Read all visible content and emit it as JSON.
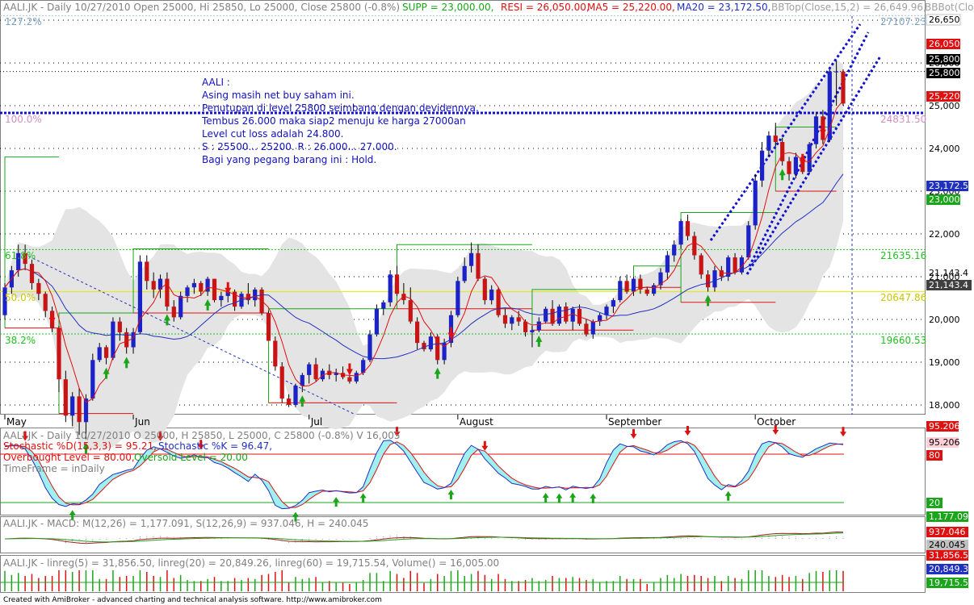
{
  "colors": {
    "up": "#1a22c8",
    "down": "#c81414",
    "ma5": "#e01010",
    "ma20": "#2030c0",
    "band": "#e6e6e6",
    "supp": "#1aa51a",
    "resi": "#e01010",
    "fib_green": "#22c022",
    "fib_yellow": "#e8e800",
    "cyan": "#80ffff"
  },
  "header": {
    "symbol_line": "AALI.JK - Daily 10/27/2010 Open 25000, Hi 25850, Lo 25000, Close 25800 (-0.8%)",
    "supp": "SUPP = 23,000.00,",
    "resi": "RESI = 26,050.00,",
    "ma5": "MA5 = 25,220.00,",
    "ma20": "MA20 = 23,172.50,",
    "bbtop": "BBTop(Close,15,2) = 26,649.96,",
    "bbbot": "BBBot(Clo"
  },
  "annotation": [
    "AALI :",
    "Asing masih net buy saham ini.",
    "Penutupan di level 25800 seimbang dengan devidennya.",
    "Tembus 26.000 maka siap2 menuju ke harga 27000an",
    "Level cut loss adalah 24.800.",
    "S : 25500... 25200. R : 26.000... 27.000.",
    "Bagi yang pegang barang ini : Hold."
  ],
  "fib_labels": {
    "f127": "127.2%",
    "f100": "100.0%",
    "f618": "61.8%",
    "f50": "50.0%",
    "f382": "38.2%",
    "v127": "27107.23",
    "v100": "24831.50",
    "v618": "21635.16",
    "v50": "20647.86",
    "v382": "19660.53"
  },
  "price_axis": {
    "ticks": [
      "27,000",
      "26,000",
      "25,000",
      "24,000",
      "23,000",
      "22,000",
      "21,000",
      "20,000",
      "19,000",
      "18,000"
    ],
    "badges": {
      "bbtop": "26,650",
      "resi": "26,050",
      "close_a": "25,800",
      "close_b": "25,800",
      "ma5": "25,220",
      "ma20": "23,172.5",
      "supp": "23,000",
      "lvl_a": "21,143.4",
      "lvl_b": "21,143.4"
    }
  },
  "months": [
    "May",
    "Jun",
    "Jul",
    "August",
    "September",
    "October"
  ],
  "stoch": {
    "title": "AALI.JK - Daily 10/27/2010 O 25000, H 25850, L 25000, C 25800 (-0.8%) V 16,005",
    "d": "Stochastic %D(15,3,3) = 95.21,",
    "k": "Stochastic %K = 96.47,",
    "ob": "Overbought Level = 80.00,",
    "os": "Oversold Level = 20.00",
    "tf": "TimeFrame = inDaily",
    "b1": "95.206",
    "b2": "95.206",
    "b3": "80",
    "b4": "20"
  },
  "macd": {
    "title": "AALI.JK - MACD: M(12,26) = 1,177.091, S(12,26,9) = 937.046, H = 240.045",
    "b1": "1,177.09",
    "b2": "937.046",
    "b3": "240.045"
  },
  "linreg": {
    "title": "AALI.JK - linreg(5) = 31,856.50, linreg(20) = 20,849.26, linreg(60) = 19,715.54, Volume() = 16,005.00",
    "b1": "31,856.5",
    "b2": "20,849.3",
    "b3": "19,715.5"
  },
  "footer": "Created with AmiBroker - advanced charting and technical analysis software. http://www.amibroker.com",
  "chart_data": {
    "type": "candlestick",
    "title": "AALI.JK - Daily 10/27/2010",
    "y_range": [
      17800,
      27000
    ],
    "ohlc": [
      [
        20100,
        20850,
        20000,
        20750
      ],
      [
        20750,
        21250,
        20600,
        21150
      ],
      [
        21150,
        21750,
        21000,
        21550
      ],
      [
        21550,
        21750,
        21150,
        21300
      ],
      [
        21300,
        21400,
        20700,
        20850
      ],
      [
        20850,
        20950,
        20450,
        20600
      ],
      [
        20600,
        20650,
        20050,
        20200
      ],
      [
        20200,
        20300,
        19700,
        19800
      ],
      [
        19800,
        19850,
        18300,
        18600
      ],
      [
        18600,
        18800,
        17600,
        17750
      ],
      [
        17750,
        18300,
        17500,
        18200
      ],
      [
        18200,
        18400,
        17300,
        17600
      ],
      [
        17600,
        18250,
        17200,
        18150
      ],
      [
        18150,
        19200,
        18100,
        19050
      ],
      [
        19050,
        19450,
        19000,
        19350
      ],
      [
        19350,
        19400,
        18950,
        19100
      ],
      [
        19100,
        20050,
        19050,
        19950
      ],
      [
        19950,
        20050,
        19500,
        19700
      ],
      [
        19700,
        19800,
        19200,
        19350
      ],
      [
        19350,
        19800,
        19200,
        19700
      ],
      [
        19700,
        21500,
        19650,
        21350
      ],
      [
        21350,
        21500,
        20700,
        20900
      ],
      [
        20900,
        21100,
        20500,
        20700
      ],
      [
        20700,
        21050,
        20500,
        20950
      ],
      [
        20950,
        21100,
        20200,
        20300
      ],
      [
        20300,
        20450,
        19950,
        20050
      ],
      [
        20050,
        20650,
        20000,
        20550
      ],
      [
        20550,
        20800,
        20400,
        20750
      ],
      [
        20750,
        20950,
        20600,
        20850
      ],
      [
        20850,
        20900,
        20550,
        20650
      ],
      [
        20650,
        21000,
        20550,
        20950
      ],
      [
        20950,
        20950,
        20400,
        20450
      ],
      [
        20450,
        20650,
        20300,
        20550
      ],
      [
        20550,
        20750,
        20400,
        20650
      ],
      [
        20650,
        20700,
        20200,
        20300
      ],
      [
        20300,
        20650,
        20250,
        20600
      ],
      [
        20600,
        20850,
        20350,
        20450
      ],
      [
        20450,
        20750,
        20300,
        20700
      ],
      [
        20700,
        20750,
        20100,
        20150
      ],
      [
        20150,
        20200,
        19500,
        19500
      ],
      [
        19500,
        19600,
        18800,
        18900
      ],
      [
        18900,
        19000,
        18050,
        18150
      ],
      [
        18150,
        18250,
        17950,
        18000
      ],
      [
        18000,
        18500,
        17950,
        18450
      ],
      [
        18450,
        18750,
        18300,
        18700
      ],
      [
        18700,
        19000,
        18500,
        18950
      ],
      [
        18950,
        19100,
        18550,
        18600
      ],
      [
        18600,
        18850,
        18550,
        18800
      ],
      [
        18800,
        18950,
        18600,
        18700
      ],
      [
        18700,
        18850,
        18550,
        18750
      ],
      [
        18750,
        18900,
        18600,
        18650
      ],
      [
        18650,
        18700,
        18500,
        18550
      ],
      [
        18550,
        18800,
        18500,
        18750
      ],
      [
        18750,
        19100,
        18700,
        19050
      ],
      [
        19050,
        19750,
        19000,
        19650
      ],
      [
        19650,
        20350,
        19600,
        20250
      ],
      [
        20250,
        20450,
        20100,
        20400
      ],
      [
        20400,
        21150,
        20300,
        21050
      ],
      [
        21050,
        21250,
        20550,
        20600
      ],
      [
        20600,
        20850,
        20350,
        20450
      ],
      [
        20450,
        20750,
        19900,
        19950
      ],
      [
        19950,
        20050,
        19300,
        19450
      ],
      [
        19450,
        19500,
        19250,
        19300
      ],
      [
        19300,
        19700,
        19250,
        19600
      ],
      [
        19600,
        19650,
        18950,
        19050
      ],
      [
        19050,
        19550,
        18950,
        19450
      ],
      [
        19450,
        20200,
        19350,
        20100
      ],
      [
        20100,
        21000,
        20050,
        20900
      ],
      [
        20900,
        21450,
        20850,
        21250
      ],
      [
        21250,
        21800,
        21100,
        21550
      ],
      [
        21550,
        21750,
        20900,
        20950
      ],
      [
        20950,
        21000,
        20350,
        20450
      ],
      [
        20450,
        20800,
        20350,
        20700
      ],
      [
        20700,
        20750,
        20050,
        20100
      ],
      [
        20100,
        20250,
        19800,
        19900
      ],
      [
        19900,
        20100,
        19750,
        20050
      ],
      [
        20050,
        20200,
        19850,
        19950
      ],
      [
        19950,
        20000,
        19600,
        19700
      ],
      [
        19700,
        19850,
        19350,
        19750
      ],
      [
        19750,
        20050,
        19700,
        19950
      ],
      [
        19950,
        20300,
        19900,
        20250
      ],
      [
        20250,
        20450,
        19850,
        19900
      ],
      [
        19900,
        20350,
        19850,
        20300
      ],
      [
        20300,
        20400,
        19900,
        19950
      ],
      [
        19950,
        20300,
        19750,
        20250
      ],
      [
        20250,
        20350,
        19850,
        19900
      ],
      [
        19900,
        20000,
        19600,
        19650
      ],
      [
        19650,
        20000,
        19550,
        19950
      ],
      [
        19950,
        20150,
        19850,
        20100
      ],
      [
        20100,
        20350,
        20000,
        20300
      ],
      [
        20300,
        20500,
        20150,
        20450
      ],
      [
        20450,
        21000,
        20400,
        20900
      ],
      [
        20900,
        21050,
        20600,
        20650
      ],
      [
        20650,
        21000,
        20550,
        20950
      ],
      [
        20950,
        21050,
        20600,
        20700
      ],
      [
        20700,
        20750,
        20550,
        20600
      ],
      [
        20600,
        20850,
        20550,
        20800
      ],
      [
        20800,
        21200,
        20700,
        21100
      ],
      [
        21100,
        21600,
        20950,
        21500
      ],
      [
        21500,
        21850,
        21350,
        21750
      ],
      [
        21750,
        22350,
        21650,
        22300
      ],
      [
        22300,
        22450,
        21850,
        21950
      ],
      [
        21950,
        22050,
        21400,
        21500
      ],
      [
        21500,
        21550,
        20950,
        21050
      ],
      [
        21050,
        21150,
        20650,
        20750
      ],
      [
        20750,
        21250,
        20650,
        21150
      ],
      [
        21150,
        21250,
        20900,
        21000
      ],
      [
        21000,
        21500,
        20900,
        21450
      ],
      [
        21450,
        21550,
        21050,
        21100
      ],
      [
        21100,
        21500,
        21050,
        21450
      ],
      [
        21450,
        22300,
        21400,
        22200
      ],
      [
        22200,
        23400,
        22100,
        23250
      ],
      [
        23250,
        24150,
        23100,
        23950
      ],
      [
        23950,
        24400,
        23800,
        24300
      ],
      [
        24300,
        24600,
        24050,
        24150
      ],
      [
        24150,
        24250,
        23600,
        23700
      ],
      [
        23700,
        23800,
        23250,
        23400
      ],
      [
        23400,
        23900,
        23300,
        23800
      ],
      [
        23800,
        23850,
        23400,
        23450
      ],
      [
        23450,
        24150,
        23400,
        24100
      ],
      [
        24100,
        24850,
        24000,
        24750
      ],
      [
        24750,
        24900,
        24100,
        24200
      ],
      [
        24200,
        25850,
        24150,
        25800
      ],
      [
        25800,
        26050,
        25000,
        25800
      ],
      [
        25800,
        25850,
        25000,
        25050
      ]
    ],
    "x_months": [
      "May",
      "Jun",
      "Jul",
      "August",
      "September",
      "October"
    ]
  }
}
